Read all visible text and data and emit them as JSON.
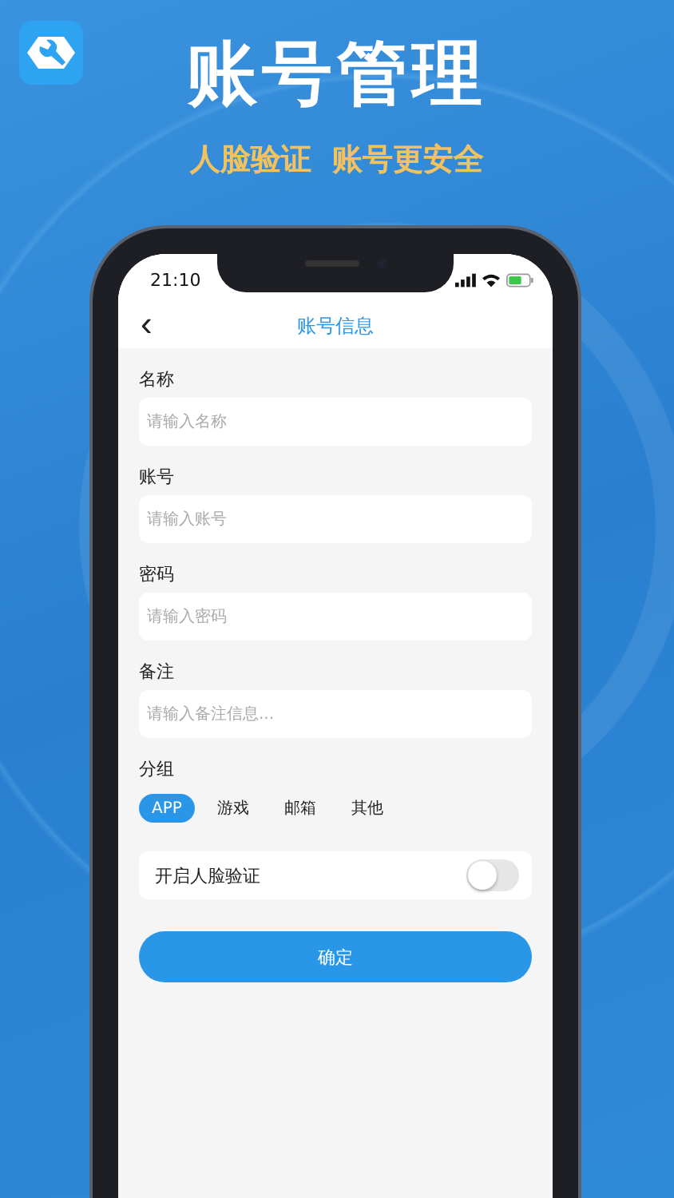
{
  "promo": {
    "title": "账号管理",
    "subtitle": "人脸验证  账号更安全"
  },
  "status_bar": {
    "time": "21:10"
  },
  "nav": {
    "back": "‹",
    "title": "账号信息"
  },
  "fields": [
    {
      "label": "名称",
      "placeholder": "请输入名称"
    },
    {
      "label": "账号",
      "placeholder": "请输入账号"
    },
    {
      "label": "密码",
      "placeholder": "请输入密码"
    },
    {
      "label": "备注",
      "placeholder": "请输入备注信息..."
    }
  ],
  "group": {
    "label": "分组",
    "options": [
      {
        "label": "APP",
        "selected": true
      },
      {
        "label": "游戏",
        "selected": false
      },
      {
        "label": "邮箱",
        "selected": false
      },
      {
        "label": "其他",
        "selected": false
      }
    ]
  },
  "face_toggle": {
    "label": "开启人脸验证",
    "on": false
  },
  "confirm_button": "确定"
}
